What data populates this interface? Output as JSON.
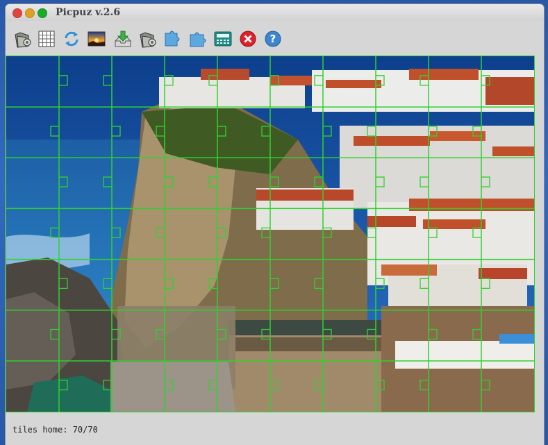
{
  "app": {
    "title": "Picpuz v.2.6"
  },
  "toolbar": {
    "buttons": [
      {
        "name": "open-image-button",
        "icon": "folder-gear-icon"
      },
      {
        "name": "grid-button",
        "icon": "grid-icon"
      },
      {
        "name": "shuffle-button",
        "icon": "refresh-icon"
      },
      {
        "name": "picture-button",
        "icon": "landscape-icon"
      },
      {
        "name": "download-button",
        "icon": "download-tray-icon"
      },
      {
        "name": "open-puzzle-button",
        "icon": "folder-gear-icon"
      },
      {
        "name": "piece-left-button",
        "icon": "puzzle-piece-icon"
      },
      {
        "name": "piece-right-button",
        "icon": "puzzle-piece-icon"
      },
      {
        "name": "calculator-button",
        "icon": "calculator-icon"
      },
      {
        "name": "quit-button",
        "icon": "close-red-icon"
      },
      {
        "name": "help-button",
        "icon": "help-icon"
      }
    ]
  },
  "puzzle": {
    "columns": 10,
    "rows": 7,
    "grid_color": "#2fd22f"
  },
  "status": {
    "text": "tiles home: 70/70"
  }
}
